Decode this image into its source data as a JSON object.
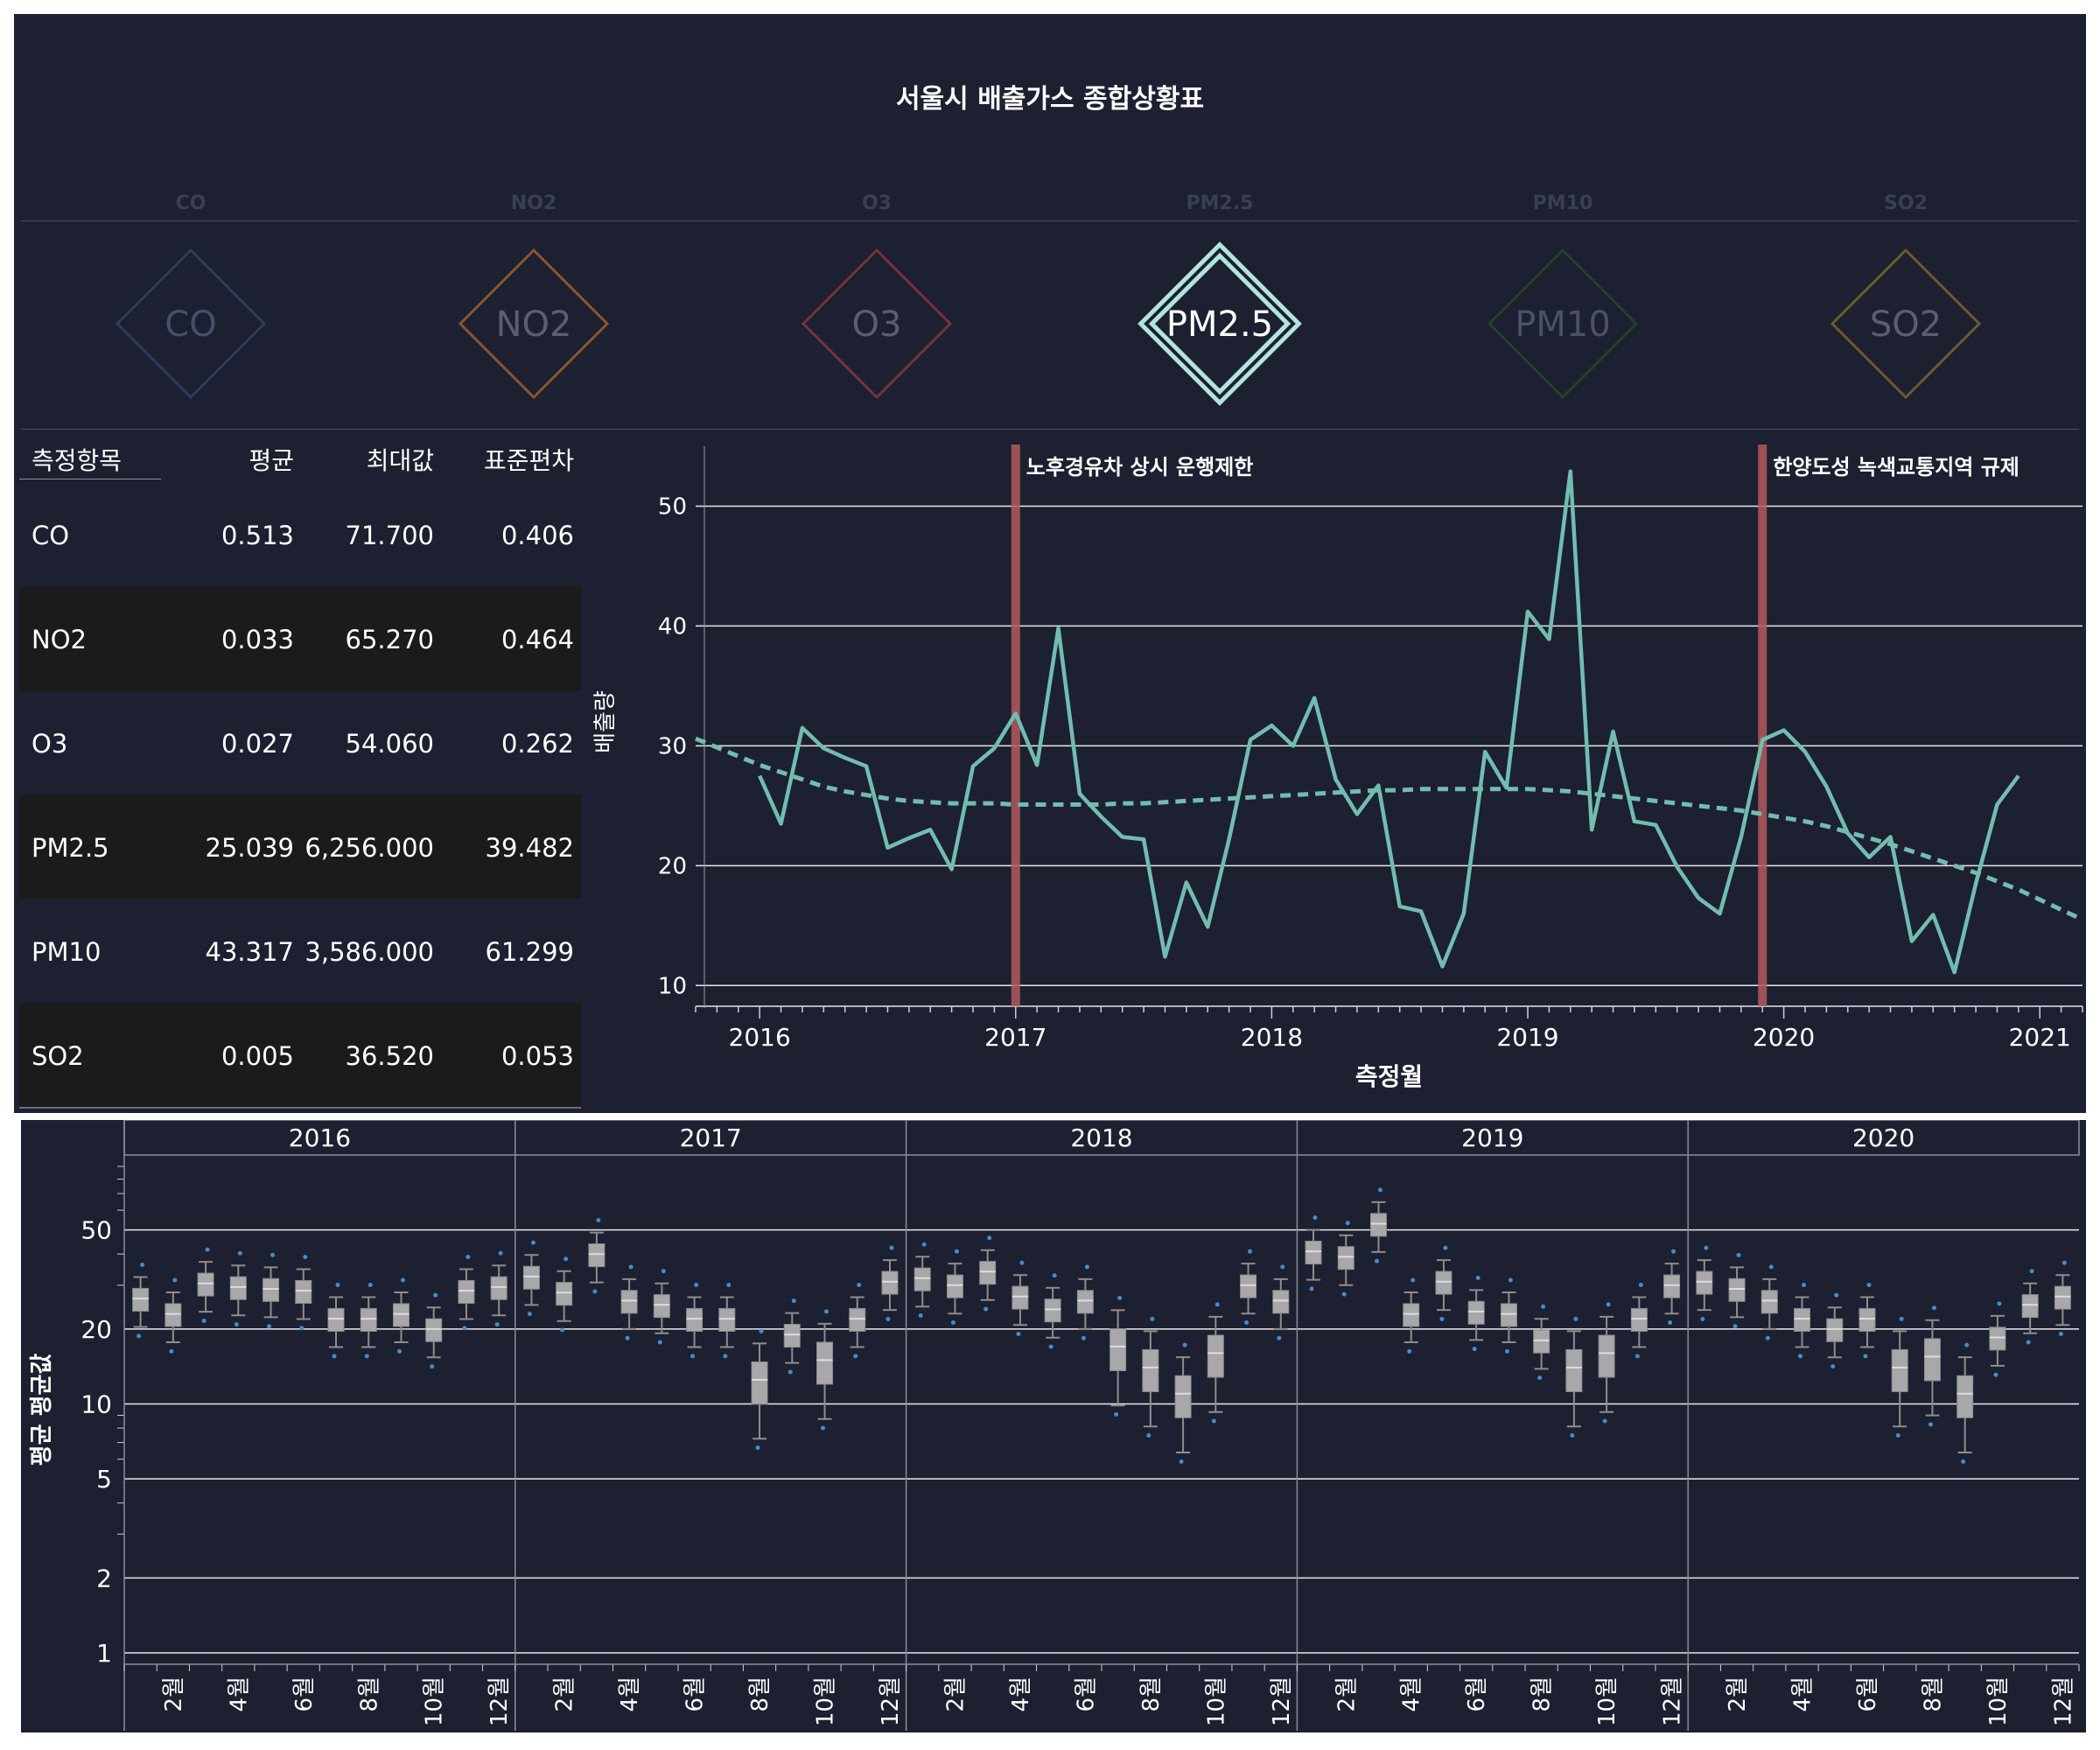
{
  "dashboard": {
    "title": "서울시 배출가스 종합상황표"
  },
  "gases": [
    {
      "label": "CO",
      "color": "#2e3d5a",
      "text_color": "#44506a",
      "selected": false
    },
    {
      "label": "NO2",
      "color": "#8a5530",
      "text_color": "#5a5e70",
      "selected": false
    },
    {
      "label": "O3",
      "color": "#7a3040",
      "text_color": "#5a5e70",
      "selected": false
    },
    {
      "label": "PM2.5",
      "color": "#b2e4dc",
      "text_color": "#ffffff",
      "selected": true
    },
    {
      "label": "PM10",
      "color": "#24402c",
      "text_color": "#4a5266",
      "selected": false
    },
    {
      "label": "SO2",
      "color": "#6a5a30",
      "text_color": "#5a5e70",
      "selected": false
    }
  ],
  "stats_table": {
    "headers": {
      "item": "측정항목",
      "mean": "평균",
      "max": "최대값",
      "std": "표준편차"
    },
    "rows": [
      {
        "item": "CO",
        "mean": "0.513",
        "max": "71.700",
        "std": "0.406"
      },
      {
        "item": "NO2",
        "mean": "0.033",
        "max": "65.270",
        "std": "0.464"
      },
      {
        "item": "O3",
        "mean": "0.027",
        "max": "54.060",
        "std": "0.262"
      },
      {
        "item": "PM2.5",
        "mean": "25.039",
        "max": "6,256.000",
        "std": "39.482"
      },
      {
        "item": "PM10",
        "mean": "43.317",
        "max": "3,586.000",
        "std": "61.299"
      },
      {
        "item": "SO2",
        "mean": "0.005",
        "max": "36.520",
        "std": "0.053"
      }
    ]
  },
  "chart_data": [
    {
      "type": "line",
      "xlabel": "측정월",
      "ylabel": "배출량",
      "x_ticks": [
        "2016",
        "2017",
        "2018",
        "2019",
        "2020",
        "2021"
      ],
      "y_ticks": [
        10,
        20,
        30,
        40,
        50
      ],
      "ylim": [
        9,
        55
      ],
      "xlim": [
        "2015-10",
        "2021-03"
      ],
      "x": [
        "2016-01",
        "2016-02",
        "2016-03",
        "2016-04",
        "2016-05",
        "2016-06",
        "2016-07",
        "2016-08",
        "2016-09",
        "2016-10",
        "2016-11",
        "2016-12",
        "2017-01",
        "2017-02",
        "2017-03",
        "2017-04",
        "2017-05",
        "2017-06",
        "2017-07",
        "2017-08",
        "2017-09",
        "2017-10",
        "2017-11",
        "2017-12",
        "2018-01",
        "2018-02",
        "2018-03",
        "2018-04",
        "2018-05",
        "2018-06",
        "2018-07",
        "2018-08",
        "2018-09",
        "2018-10",
        "2018-11",
        "2018-12",
        "2019-01",
        "2019-02",
        "2019-03",
        "2019-04",
        "2019-05",
        "2019-06",
        "2019-07",
        "2019-08",
        "2019-09",
        "2019-10",
        "2019-11",
        "2019-12",
        "2020-01",
        "2020-02",
        "2020-03",
        "2020-04",
        "2020-05",
        "2020-06",
        "2020-07",
        "2020-08",
        "2020-09",
        "2020-10",
        "2020-11",
        "2020-12"
      ],
      "series": [
        {
          "values": [
            27.5,
            23.5,
            31.5,
            29.8,
            29.0,
            28.3,
            21.5,
            22.3,
            23.0,
            19.7,
            28.3,
            29.8,
            32.7,
            28.4,
            39.8,
            26.0,
            24.1,
            22.4,
            22.2,
            12.4,
            18.6,
            14.9,
            22.2,
            30.5,
            31.7,
            30.0,
            34.0,
            27.2,
            24.3,
            26.7,
            16.6,
            16.2,
            11.6,
            16.0,
            29.5,
            26.5,
            41.2,
            38.9,
            52.9,
            23.0,
            31.2,
            23.7,
            23.4,
            19.9,
            17.3,
            16.0,
            22.4,
            30.5,
            31.3,
            29.5,
            26.6,
            22.7,
            20.7,
            22.4,
            13.7,
            15.9,
            11.1,
            18.5,
            25.1,
            27.5
          ]
        },
        {
          "values": [
            28.4,
            27.8,
            27.2,
            26.6,
            26.2,
            25.9,
            25.6,
            25.4,
            25.3,
            25.2,
            25.2,
            25.2,
            25.1,
            25.1,
            25.1,
            25.1,
            25.1,
            25.2,
            25.2,
            25.3,
            25.4,
            25.5,
            25.6,
            25.7,
            25.8,
            25.9,
            26.0,
            26.1,
            26.2,
            26.3,
            26.3,
            26.4,
            26.4,
            26.4,
            26.4,
            26.4,
            26.4,
            26.3,
            26.2,
            26.0,
            25.8,
            25.6,
            25.4,
            25.2,
            25.0,
            24.8,
            24.6,
            24.3,
            24.0,
            23.7,
            23.3,
            22.8,
            22.3,
            21.8,
            21.2,
            20.6,
            20.0,
            19.4,
            18.7,
            18.0
          ]
        }
      ],
      "annotations": [
        {
          "date": "2017-01",
          "label": "노후경유차 상시 운행제한"
        },
        {
          "date": "2019-12",
          "label": "한양도성 녹색교통지역 규제"
        }
      ]
    },
    {
      "type": "box",
      "ylabel": "평균 평균값",
      "scale": "log",
      "y_ticks": [
        1,
        2,
        5,
        10,
        20,
        50
      ],
      "ylim": [
        0.9,
        100
      ],
      "years": [
        "2016",
        "2017",
        "2018",
        "2019",
        "2020"
      ],
      "month_labels": [
        "2월",
        "4월",
        "6월",
        "8월",
        "10월",
        "12월"
      ],
      "medians": [
        [
          26.5,
          23.0,
          30.5,
          29.5,
          29.0,
          28.5,
          22.0,
          22.0,
          23.0,
          20.0,
          28.5,
          29.5
        ],
        [
          32.5,
          28.0,
          40.0,
          26.0,
          25.0,
          22.0,
          22.0,
          12.5,
          19.0,
          15.0,
          22.0,
          31.0
        ],
        [
          32.0,
          30.0,
          34.0,
          27.0,
          24.0,
          26.0,
          17.0,
          14.0,
          11.0,
          16.0,
          30.0,
          26.0
        ],
        [
          41.0,
          39.0,
          53.0,
          23.0,
          31.0,
          23.5,
          23.0,
          18.0,
          14.0,
          16.0,
          22.0,
          30.0
        ],
        [
          31.0,
          29.0,
          26.0,
          22.0,
          20.0,
          22.0,
          14.0,
          15.5,
          11.0,
          18.5,
          25.0,
          27.0
        ]
      ]
    }
  ]
}
